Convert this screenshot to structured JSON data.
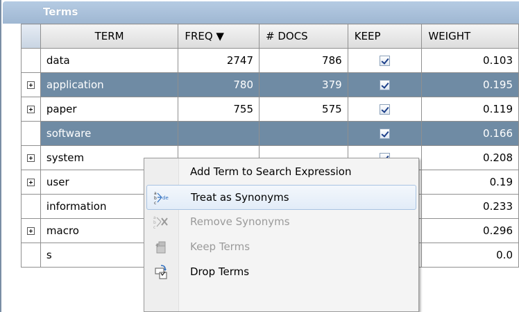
{
  "panel": {
    "title": "Terms"
  },
  "columns": {
    "term": "TERM",
    "freq": "FREQ ▼",
    "docs": "# DOCS",
    "keep": "KEEP",
    "weight": "WEIGHT"
  },
  "rows": [
    {
      "term": "data",
      "freq": "2747",
      "docs": "786",
      "keep": true,
      "weight": "0.103",
      "expandable": false,
      "selected": false
    },
    {
      "term": "application",
      "freq": "780",
      "docs": "379",
      "keep": true,
      "weight": "0.195",
      "expandable": true,
      "selected": true
    },
    {
      "term": "paper",
      "freq": "755",
      "docs": "575",
      "keep": true,
      "weight": "0.119",
      "expandable": true,
      "selected": false
    },
    {
      "term": "software",
      "freq": "",
      "docs": "",
      "keep": true,
      "weight": "0.166",
      "expandable": false,
      "selected": true
    },
    {
      "term": "system",
      "freq": "",
      "docs": "",
      "keep": true,
      "weight": "0.208",
      "expandable": true,
      "selected": false
    },
    {
      "term": "user",
      "freq": "",
      "docs": "",
      "keep": true,
      "weight": "0.19",
      "expandable": true,
      "selected": false
    },
    {
      "term": "information",
      "freq": "",
      "docs": "",
      "keep": true,
      "weight": "0.233",
      "expandable": false,
      "selected": false
    },
    {
      "term": "macro",
      "freq": "",
      "docs": "",
      "keep": true,
      "weight": "0.296",
      "expandable": true,
      "selected": false
    },
    {
      "term": "s",
      "freq": "",
      "docs": "",
      "keep": true,
      "weight": "0.0",
      "expandable": false,
      "selected": false
    }
  ],
  "context_menu": {
    "items": [
      {
        "label": "Add Term to Search Expression",
        "icon": "none",
        "enabled": true,
        "hover": false
      },
      {
        "label": "Treat as Synonyms",
        "icon": "synonyms-icon",
        "enabled": true,
        "hover": true
      },
      {
        "label": "Remove Synonyms",
        "icon": "remove-synonyms-icon",
        "enabled": false,
        "hover": false
      },
      {
        "label": "Keep Terms",
        "icon": "keep-terms-icon",
        "enabled": false,
        "hover": false
      },
      {
        "label": "Drop Terms",
        "icon": "drop-terms-icon",
        "enabled": true,
        "hover": false
      }
    ]
  }
}
